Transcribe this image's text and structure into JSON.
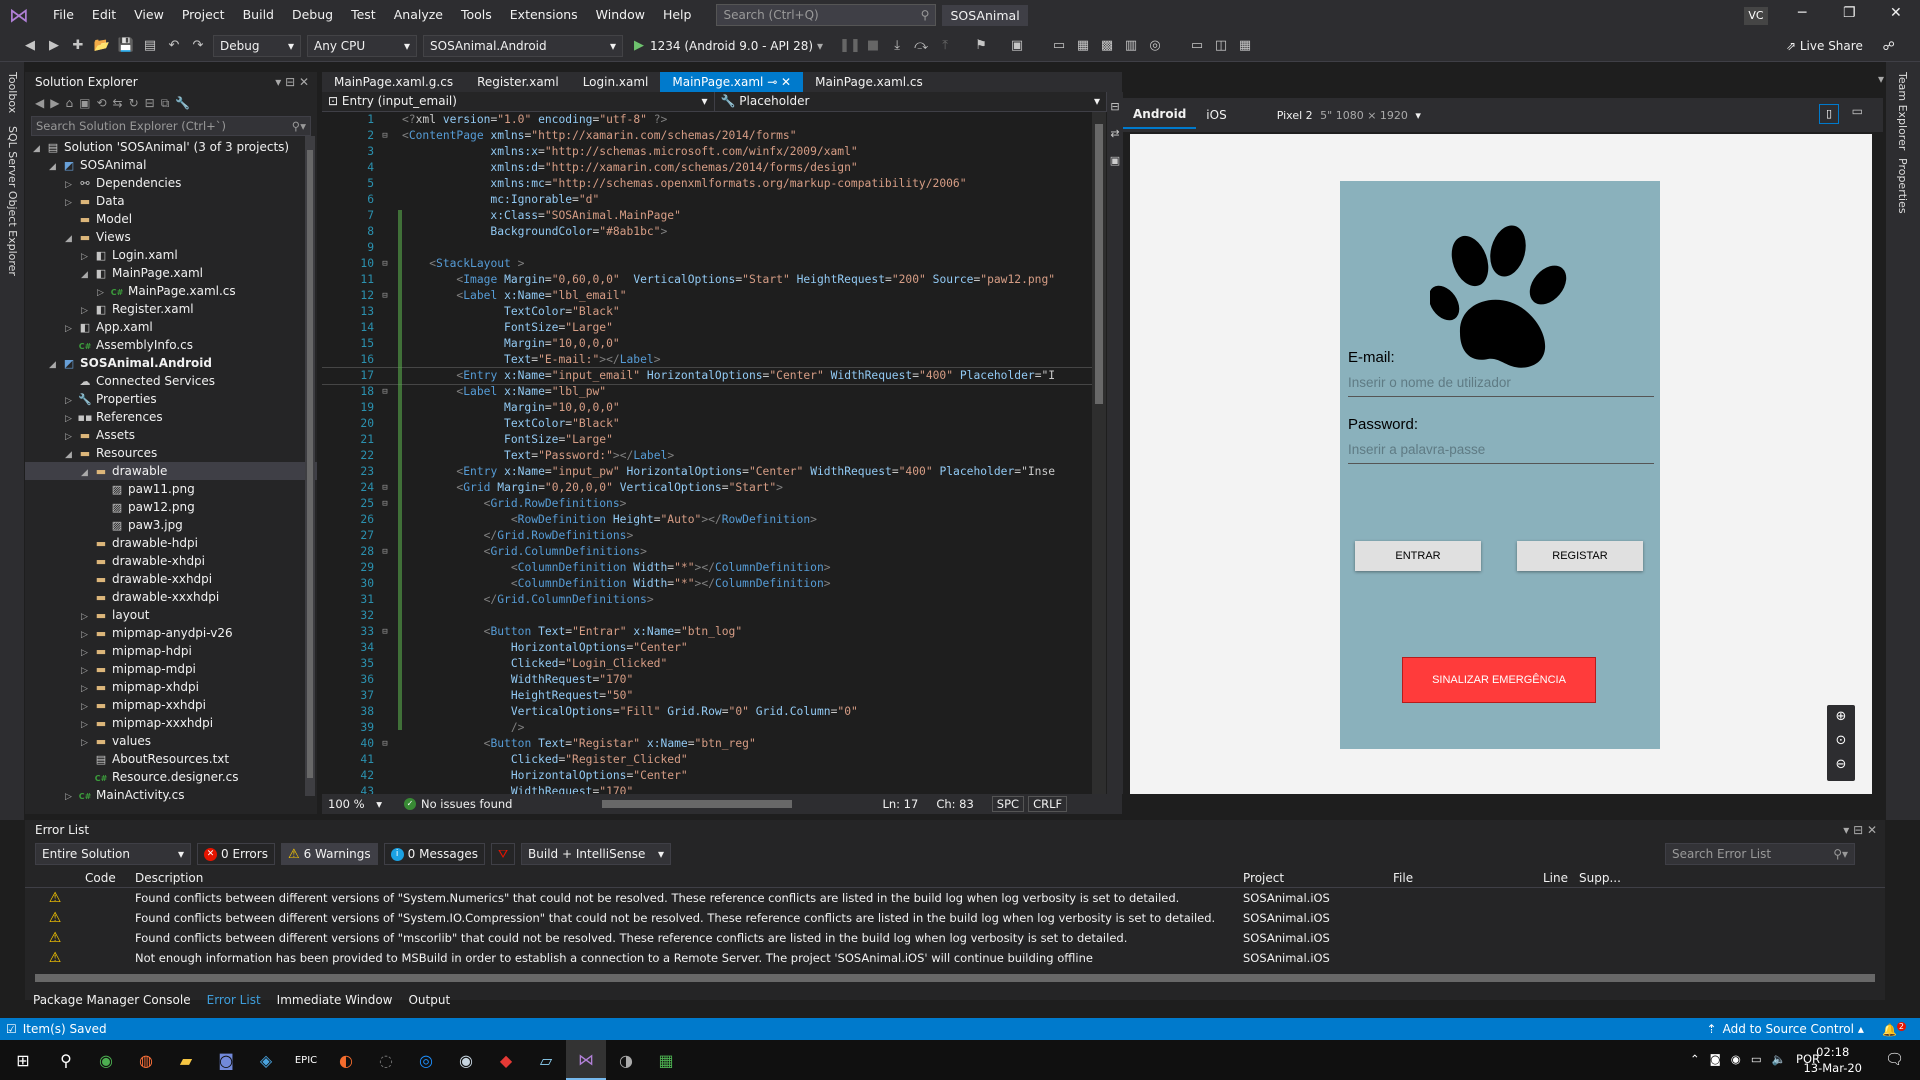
{
  "titlebar": {
    "menus": [
      "File",
      "Edit",
      "View",
      "Project",
      "Build",
      "Debug",
      "Test",
      "Analyze",
      "Tools",
      "Extensions",
      "Window",
      "Help"
    ],
    "search_placeholder": "Search (Ctrl+Q)",
    "solution_name": "SOSAnimal",
    "user_initials": "VC"
  },
  "toolbar": {
    "config": "Debug",
    "platform": "Any CPU",
    "startup_project": "SOSAnimal.Android",
    "run_target": "1234 (Android 9.0 - API 28)",
    "live_share": "Live Share"
  },
  "side_labels": {
    "toolbox": "Toolbox",
    "sql": "SQL Server Object Explorer",
    "team": "Team Explorer",
    "props": "Properties"
  },
  "solution_explorer": {
    "title": "Solution Explorer",
    "search_placeholder": "Search Solution Explorer (Ctrl+`)",
    "items": [
      {
        "label": "Solution 'SOSAnimal' (3 of 3 projects)",
        "indent": 0,
        "arrow": "◢",
        "icon": "solution"
      },
      {
        "label": "SOSAnimal",
        "indent": 1,
        "arrow": "◢",
        "icon": "project"
      },
      {
        "label": "Dependencies",
        "indent": 2,
        "arrow": "▷",
        "icon": "deps"
      },
      {
        "label": "Data",
        "indent": 2,
        "arrow": "▷",
        "icon": "folder"
      },
      {
        "label": "Model",
        "indent": 2,
        "arrow": "",
        "icon": "folder"
      },
      {
        "label": "Views",
        "indent": 2,
        "arrow": "◢",
        "icon": "folder"
      },
      {
        "label": "Login.xaml",
        "indent": 3,
        "arrow": "▷",
        "icon": "xaml"
      },
      {
        "label": "MainPage.xaml",
        "indent": 3,
        "arrow": "◢",
        "icon": "xaml"
      },
      {
        "label": "MainPage.xaml.cs",
        "indent": 4,
        "arrow": "▷",
        "icon": "cs"
      },
      {
        "label": "Register.xaml",
        "indent": 3,
        "arrow": "▷",
        "icon": "xaml"
      },
      {
        "label": "App.xaml",
        "indent": 2,
        "arrow": "▷",
        "icon": "xaml"
      },
      {
        "label": "AssemblyInfo.cs",
        "indent": 2,
        "arrow": "",
        "icon": "cs"
      },
      {
        "label": "SOSAnimal.Android",
        "indent": 1,
        "arrow": "◢",
        "icon": "project",
        "bold": true
      },
      {
        "label": "Connected Services",
        "indent": 2,
        "arrow": "",
        "icon": "conn"
      },
      {
        "label": "Properties",
        "indent": 2,
        "arrow": "▷",
        "icon": "wrench"
      },
      {
        "label": "References",
        "indent": 2,
        "arrow": "▷",
        "icon": "refs"
      },
      {
        "label": "Assets",
        "indent": 2,
        "arrow": "▷",
        "icon": "folder"
      },
      {
        "label": "Resources",
        "indent": 2,
        "arrow": "◢",
        "icon": "folder"
      },
      {
        "label": "drawable",
        "indent": 3,
        "arrow": "◢",
        "icon": "folder",
        "selected": true
      },
      {
        "label": "paw11.png",
        "indent": 4,
        "arrow": "",
        "icon": "img"
      },
      {
        "label": "paw12.png",
        "indent": 4,
        "arrow": "",
        "icon": "img"
      },
      {
        "label": "paw3.jpg",
        "indent": 4,
        "arrow": "",
        "icon": "img"
      },
      {
        "label": "drawable-hdpi",
        "indent": 3,
        "arrow": "",
        "icon": "folder"
      },
      {
        "label": "drawable-xhdpi",
        "indent": 3,
        "arrow": "",
        "icon": "folder"
      },
      {
        "label": "drawable-xxhdpi",
        "indent": 3,
        "arrow": "",
        "icon": "folder"
      },
      {
        "label": "drawable-xxxhdpi",
        "indent": 3,
        "arrow": "",
        "icon": "folder"
      },
      {
        "label": "layout",
        "indent": 3,
        "arrow": "▷",
        "icon": "folder"
      },
      {
        "label": "mipmap-anydpi-v26",
        "indent": 3,
        "arrow": "▷",
        "icon": "folder"
      },
      {
        "label": "mipmap-hdpi",
        "indent": 3,
        "arrow": "▷",
        "icon": "folder"
      },
      {
        "label": "mipmap-mdpi",
        "indent": 3,
        "arrow": "▷",
        "icon": "folder"
      },
      {
        "label": "mipmap-xhdpi",
        "indent": 3,
        "arrow": "▷",
        "icon": "folder"
      },
      {
        "label": "mipmap-xxhdpi",
        "indent": 3,
        "arrow": "▷",
        "icon": "folder"
      },
      {
        "label": "mipmap-xxxhdpi",
        "indent": 3,
        "arrow": "▷",
        "icon": "folder"
      },
      {
        "label": "values",
        "indent": 3,
        "arrow": "▷",
        "icon": "folder"
      },
      {
        "label": "AboutResources.txt",
        "indent": 3,
        "arrow": "",
        "icon": "txt"
      },
      {
        "label": "Resource.designer.cs",
        "indent": 3,
        "arrow": "",
        "icon": "cs"
      },
      {
        "label": "MainActivity.cs",
        "indent": 2,
        "arrow": "▷",
        "icon": "cs"
      }
    ]
  },
  "editor": {
    "tabs": [
      {
        "label": "MainPage.xaml.g.cs",
        "active": false
      },
      {
        "label": "Register.xaml",
        "active": false
      },
      {
        "label": "Login.xaml",
        "active": false
      },
      {
        "label": "MainPage.xaml",
        "active": true
      },
      {
        "label": "MainPage.xaml.cs",
        "active": false
      }
    ],
    "nav_left": "Entry (input_email)",
    "nav_right": "Placeholder",
    "lines": [
      "<?xml version=\"1.0\" encoding=\"utf-8\" ?>",
      "<ContentPage xmlns=\"http://xamarin.com/schemas/2014/forms\"",
      "             xmlns:x=\"http://schemas.microsoft.com/winfx/2009/xaml\"",
      "             xmlns:d=\"http://xamarin.com/schemas/2014/forms/design\"",
      "             xmlns:mc=\"http://schemas.openxmlformats.org/markup-compatibility/2006\"",
      "             mc:Ignorable=\"d\"",
      "             x:Class=\"SOSAnimal.MainPage\"",
      "             BackgroundColor=\"#8ab1bc\">",
      "",
      "    <StackLayout >",
      "        <Image Margin=\"0,60,0,0\"  VerticalOptions=\"Start\" HeightRequest=\"200\" Source=\"paw12.png\"",
      "        <Label x:Name=\"lbl_email\"",
      "               TextColor=\"Black\"",
      "               FontSize=\"Large\"",
      "               Margin=\"10,0,0,0\"",
      "               Text=\"E-mail:\"></Label>",
      "        <Entry x:Name=\"input_email\" HorizontalOptions=\"Center\" WidthRequest=\"400\" Placeholder=\"I",
      "        <Label x:Name=\"lbl_pw\"",
      "               Margin=\"10,0,0,0\"",
      "               TextColor=\"Black\"",
      "               FontSize=\"Large\"",
      "               Text=\"Password:\"></Label>",
      "        <Entry x:Name=\"input_pw\" HorizontalOptions=\"Center\" WidthRequest=\"400\" Placeholder=\"Inse",
      "        <Grid Margin=\"0,20,0,0\" VerticalOptions=\"Start\">",
      "            <Grid.RowDefinitions>",
      "                <RowDefinition Height=\"Auto\"></RowDefinition>",
      "            </Grid.RowDefinitions>",
      "            <Grid.ColumnDefinitions>",
      "                <ColumnDefinition Width=\"*\"></ColumnDefinition>",
      "                <ColumnDefinition Width=\"*\"></ColumnDefinition>",
      "            </Grid.ColumnDefinitions>",
      "",
      "            <Button Text=\"Entrar\" x:Name=\"btn_log\"",
      "                HorizontalOptions=\"Center\"",
      "                Clicked=\"Login_Clicked\"",
      "                WidthRequest=\"170\"",
      "                HeightRequest=\"50\"",
      "                VerticalOptions=\"Fill\" Grid.Row=\"0\" Grid.Column=\"0\"",
      "                />",
      "            <Button Text=\"Registar\" x:Name=\"btn_reg\"",
      "                Clicked=\"Register_Clicked\"",
      "                HorizontalOptions=\"Center\"",
      "                WidthRequest=\"170\""
    ],
    "fold_lines": [
      2,
      10,
      12,
      18,
      24,
      25,
      28,
      33,
      40
    ],
    "current_line": 17,
    "zoom": "100 %",
    "issues": "No issues found",
    "ln": "Ln: 17",
    "ch": "Ch: 83",
    "spc": "SPC",
    "crlf": "CRLF"
  },
  "preview": {
    "tabs": [
      "Android",
      "iOS"
    ],
    "device": "Pixel 2",
    "device_size": "5\" 1080 × 1920",
    "bg_color": "#8ab1bc",
    "email_label": "E-mail:",
    "email_placeholder": "Inserir o nome de utilizador",
    "password_label": "Password:",
    "password_placeholder": "Inserir a palavra-passe",
    "login_button": "ENTRAR",
    "register_button": "REGISTAR",
    "emergency_button": "SINALIZAR EMERGÊNCIA"
  },
  "error_list": {
    "title": "Error List",
    "scope": "Entire Solution",
    "errors": "0 Errors",
    "warnings": "6 Warnings",
    "messages": "0 Messages",
    "filter": "Build + IntelliSense",
    "search_placeholder": "Search Error List",
    "columns": [
      "Code",
      "Description",
      "Project",
      "File",
      "Line",
      "Supp..."
    ],
    "rows": [
      {
        "description": "Found conflicts between different versions of \"System.Numerics\" that could not be resolved.  These reference conflicts are listed in the build log when log verbosity is set to detailed.",
        "project": "SOSAnimal.iOS"
      },
      {
        "description": "Found conflicts between different versions of \"System.IO.Compression\" that could not be resolved.  These reference conflicts are listed in the build log when log verbosity is set to detailed.",
        "project": "SOSAnimal.iOS"
      },
      {
        "description": "Found conflicts between different versions of \"mscorlib\" that could not be resolved.  These reference conflicts are listed in the build log when log verbosity is set to detailed.",
        "project": "SOSAnimal.iOS"
      },
      {
        "description": "Not enough information has been provided to MSBuild in order to establish a connection to a Remote Server. The project 'SOSAnimal.iOS' will continue building offline",
        "project": "SOSAnimal.iOS"
      }
    ]
  },
  "bottom_tabs": [
    "Package Manager Console",
    "Error List",
    "Immediate Window",
    "Output"
  ],
  "statusbar": {
    "left": "Item(s) Saved",
    "right": "Add to Source Control",
    "notif": "2"
  },
  "taskbar": {
    "lang": "POR",
    "time": "02:18",
    "date": "13-Mar-20",
    "notif": "2"
  }
}
